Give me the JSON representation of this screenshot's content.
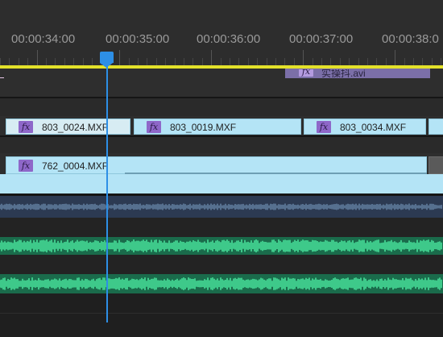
{
  "ruler": {
    "timecodes": [
      "00:00:34:00",
      "00:00:35:00",
      "00:00:36:00",
      "00:00:37:00",
      "00:00:38:0"
    ]
  },
  "clips": {
    "top_partial": {
      "fx_label": "fx",
      "name": "实操抖.avi"
    },
    "v2": [
      {
        "fx_label": "fx",
        "name": "803_0024.MXF"
      },
      {
        "fx_label": "fx",
        "name": "803_0019.MXF"
      },
      {
        "fx_label": "fx",
        "name": "803_0034.MXF"
      }
    ],
    "v1": [
      {
        "fx_label": "fx",
        "name": "762_0004.MXF"
      }
    ]
  },
  "colors": {
    "playhead": "#2d8fe6",
    "work_area_bar": "#e3e12a",
    "video_clip": "#b4e4f6",
    "audio_waveform": "#3ec98a",
    "fx_badge": "#8e67c9"
  }
}
